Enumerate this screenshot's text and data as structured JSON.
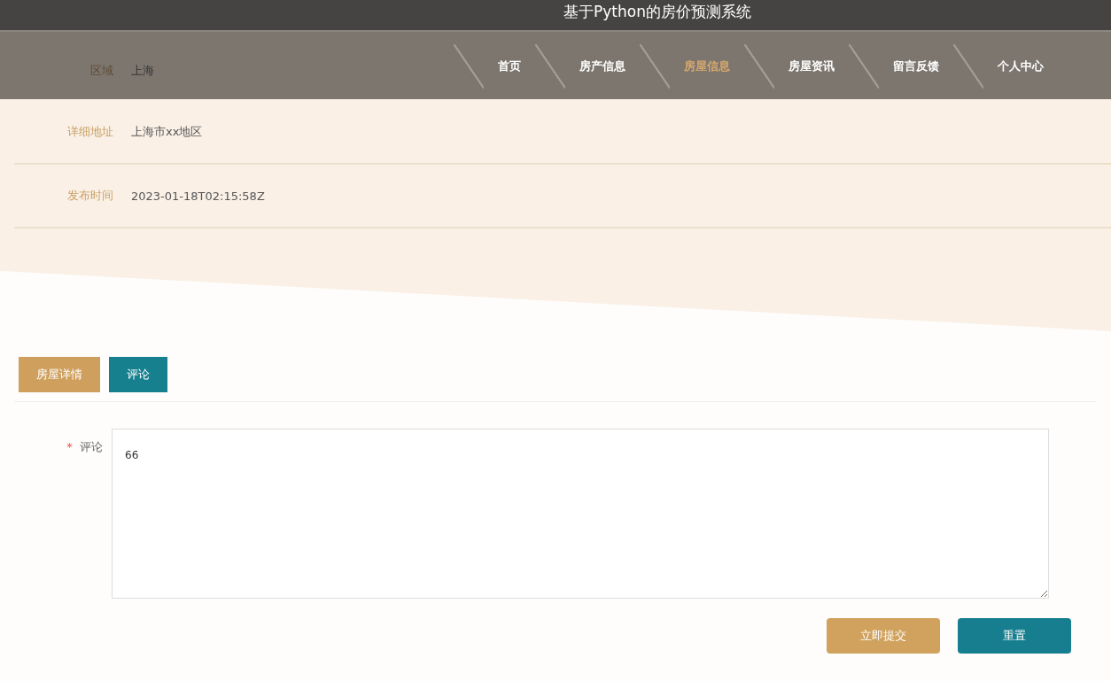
{
  "header": {
    "title": "基于Python的房价预测系统"
  },
  "nav": [
    {
      "label": "首页",
      "selected": false
    },
    {
      "label": "房产信息",
      "selected": false
    },
    {
      "label": "房屋信息",
      "selected": true
    },
    {
      "label": "房屋资讯",
      "selected": false
    },
    {
      "label": "留言反馈",
      "selected": false
    },
    {
      "label": "个人中心",
      "selected": false
    }
  ],
  "details": [
    {
      "label": "区域",
      "value": "上海"
    },
    {
      "label": "详细地址",
      "value": "上海市xx地区"
    },
    {
      "label": "发布时间",
      "value": "2023-01-18T02:15:58Z"
    }
  ],
  "tabs": [
    {
      "label": "房屋详情",
      "selected": false
    },
    {
      "label": "评论",
      "selected": true
    }
  ],
  "form": {
    "required_mark": "*",
    "label": "评论",
    "value": "66"
  },
  "buttons": [
    {
      "label": "立即提交",
      "kind": "submit"
    },
    {
      "label": "重置",
      "kind": "reset"
    }
  ]
}
